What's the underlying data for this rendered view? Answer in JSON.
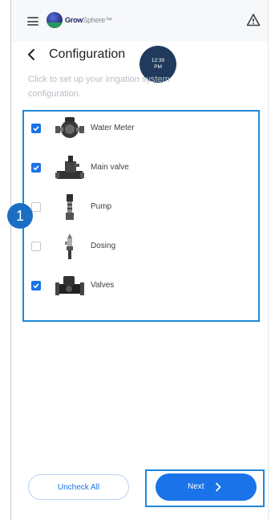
{
  "header": {
    "brand_name_strong": "Grow",
    "brand_name_light": "Sphere",
    "brand_suffix": "™"
  },
  "title": {
    "text": "Configuration",
    "subtitle": "Click to set up your irrigation system configuration.",
    "time_line1": "12:39",
    "time_line2": "PM"
  },
  "components": [
    {
      "label": "Water Meter",
      "checked": true,
      "icon": "water-meter-icon"
    },
    {
      "label": "Main valve",
      "checked": true,
      "icon": "main-valve-icon"
    },
    {
      "label": "Pump",
      "checked": false,
      "icon": "pump-icon"
    },
    {
      "label": "Dosing",
      "checked": false,
      "icon": "dosing-icon"
    },
    {
      "label": "Valves",
      "checked": true,
      "icon": "valves-icon"
    }
  ],
  "annotation": {
    "step_number": "1"
  },
  "footer": {
    "uncheck_all_label": "Uncheck All",
    "next_label": "Next"
  },
  "colors": {
    "accent": "#1a73e8",
    "highlight_border": "#1e88d8",
    "badge": "#1a6fc4"
  }
}
